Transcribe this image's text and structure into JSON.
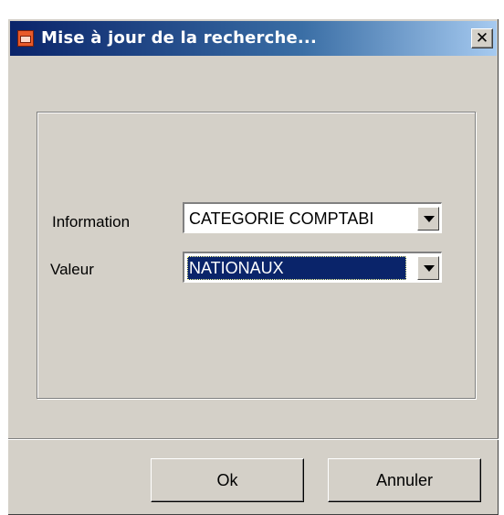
{
  "window": {
    "title": "Mise à jour de la recherche...",
    "close_glyph": "✕"
  },
  "form": {
    "information_label": "Information",
    "information_value": "CATEGORIE COMPTABI",
    "valeur_label": "Valeur",
    "valeur_value": "NATIONAUX"
  },
  "buttons": {
    "ok_label": "Ok",
    "cancel_label": "Annuler"
  },
  "colors": {
    "titlebar_start": "#0a246a",
    "titlebar_end": "#a6caf0",
    "window_bg": "#d4d0c8",
    "selection_bg": "#0a246a"
  }
}
